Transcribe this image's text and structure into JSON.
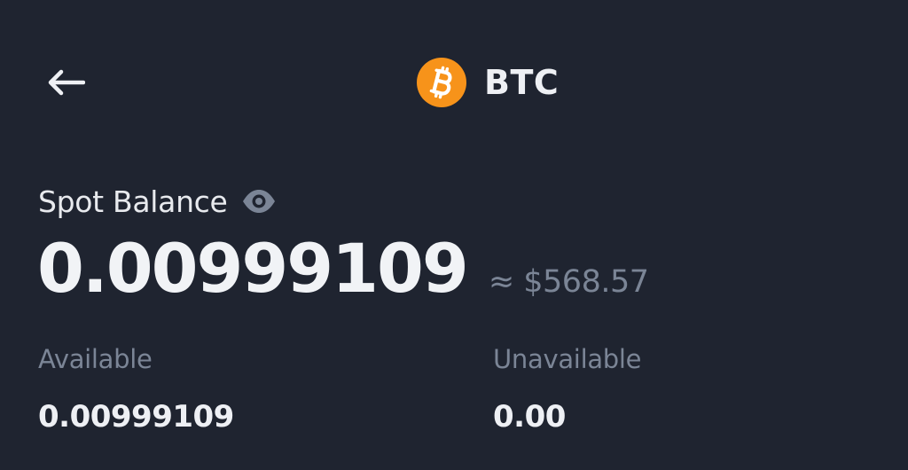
{
  "colors": {
    "background": "#1f2430",
    "accent_coin": "#f7931a",
    "primary_text": "#eef0f4",
    "secondary_text": "#7b8596"
  },
  "header": {
    "back_icon": "arrow-left-icon",
    "coin_icon": "bitcoin-icon",
    "coin_symbol": "BTC"
  },
  "balance": {
    "label": "Spot Balance",
    "visibility_icon": "eye-icon",
    "amount": "0.00999109",
    "approx_fiat": "≈ $568.57"
  },
  "breakdown": {
    "available_label": "Available",
    "available_value": "0.00999109",
    "unavailable_label": "Unavailable",
    "unavailable_value": "0.00"
  }
}
